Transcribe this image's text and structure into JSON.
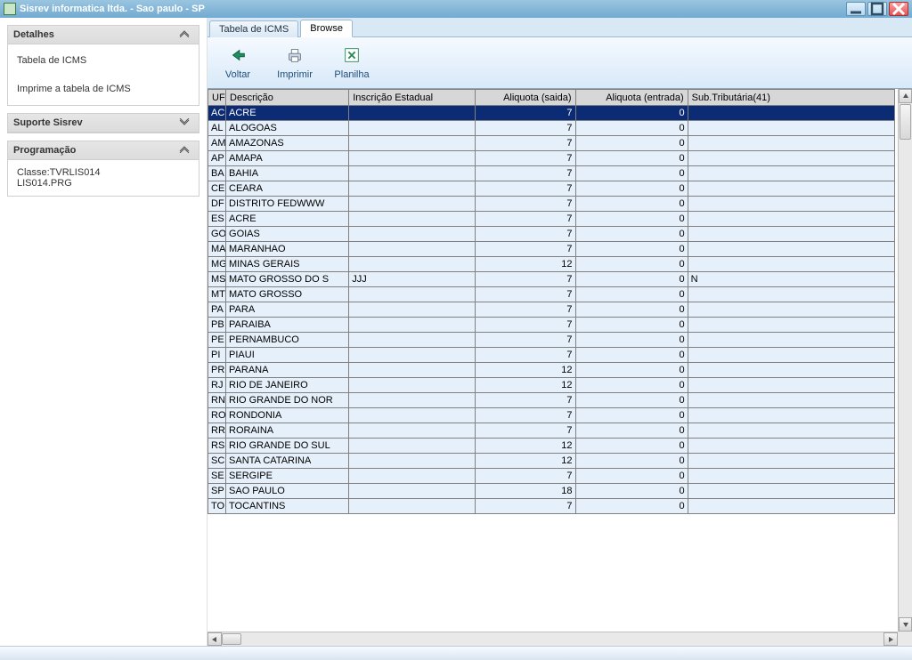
{
  "window": {
    "title": "Sisrev informatica ltda. - Sao paulo - SP"
  },
  "sidebar": {
    "detalhes": {
      "title": "Detalhes",
      "item1": "Tabela de ICMS",
      "item2": "Imprime a tabela de ICMS"
    },
    "suporte": {
      "title": "Suporte Sisrev"
    },
    "programacao": {
      "title": "Programação",
      "line1": "Classe:TVRLIS014",
      "line2": "LIS014.PRG"
    }
  },
  "tabs": {
    "tab1": "Tabela de ICMS",
    "tab2": "Browse"
  },
  "toolbar": {
    "voltar": "Voltar",
    "imprimir": "Imprimir",
    "planilha": "Planilha"
  },
  "grid": {
    "headers": {
      "uf": "UF",
      "desc": "Descrição",
      "insc": "Inscrição Estadual",
      "aliqs": "Aliquota (saida)",
      "aliqe": "Aliquota (entrada)",
      "sub": "Sub.Tributária(41)"
    },
    "rows": [
      {
        "uf": "AC",
        "desc": "ACRE",
        "insc": "",
        "aliqs": "7",
        "aliqe": "0",
        "sub": ""
      },
      {
        "uf": "AL",
        "desc": "ALOGOAS",
        "insc": "",
        "aliqs": "7",
        "aliqe": "0",
        "sub": ""
      },
      {
        "uf": "AM",
        "desc": "AMAZONAS",
        "insc": "",
        "aliqs": "7",
        "aliqe": "0",
        "sub": ""
      },
      {
        "uf": "AP",
        "desc": "AMAPA",
        "insc": "",
        "aliqs": "7",
        "aliqe": "0",
        "sub": ""
      },
      {
        "uf": "BA",
        "desc": "BAHIA",
        "insc": "",
        "aliqs": "7",
        "aliqe": "0",
        "sub": ""
      },
      {
        "uf": "CE",
        "desc": "CEARA",
        "insc": "",
        "aliqs": "7",
        "aliqe": "0",
        "sub": ""
      },
      {
        "uf": "DF",
        "desc": "DISTRITO FEDWWW",
        "insc": "",
        "aliqs": "7",
        "aliqe": "0",
        "sub": ""
      },
      {
        "uf": "ES",
        "desc": "ACRE",
        "insc": "",
        "aliqs": "7",
        "aliqe": "0",
        "sub": ""
      },
      {
        "uf": "GO",
        "desc": "GOIAS",
        "insc": "",
        "aliqs": "7",
        "aliqe": "0",
        "sub": ""
      },
      {
        "uf": "MA",
        "desc": "MARANHAO",
        "insc": "",
        "aliqs": "7",
        "aliqe": "0",
        "sub": ""
      },
      {
        "uf": "MG",
        "desc": "MINAS GERAIS",
        "insc": "",
        "aliqs": "12",
        "aliqe": "0",
        "sub": ""
      },
      {
        "uf": "MS",
        "desc": "MATO GROSSO DO S",
        "insc": "JJJ",
        "aliqs": "7",
        "aliqe": "0",
        "sub": "N"
      },
      {
        "uf": "MT",
        "desc": "MATO GROSSO",
        "insc": "",
        "aliqs": "7",
        "aliqe": "0",
        "sub": ""
      },
      {
        "uf": "PA",
        "desc": "PARA",
        "insc": "",
        "aliqs": "7",
        "aliqe": "0",
        "sub": ""
      },
      {
        "uf": "PB",
        "desc": "PARAIBA",
        "insc": "",
        "aliqs": "7",
        "aliqe": "0",
        "sub": ""
      },
      {
        "uf": "PE",
        "desc": "PERNAMBUCO",
        "insc": "",
        "aliqs": "7",
        "aliqe": "0",
        "sub": ""
      },
      {
        "uf": "PI",
        "desc": "PIAUI",
        "insc": "",
        "aliqs": "7",
        "aliqe": "0",
        "sub": ""
      },
      {
        "uf": "PR",
        "desc": "PARANA",
        "insc": "",
        "aliqs": "12",
        "aliqe": "0",
        "sub": ""
      },
      {
        "uf": "RJ",
        "desc": "RIO DE JANEIRO",
        "insc": "",
        "aliqs": "12",
        "aliqe": "0",
        "sub": ""
      },
      {
        "uf": "RN",
        "desc": "RIO GRANDE DO NOR",
        "insc": "",
        "aliqs": "7",
        "aliqe": "0",
        "sub": ""
      },
      {
        "uf": "RO",
        "desc": "RONDONIA",
        "insc": "",
        "aliqs": "7",
        "aliqe": "0",
        "sub": ""
      },
      {
        "uf": "RR",
        "desc": "RORAINA",
        "insc": "",
        "aliqs": "7",
        "aliqe": "0",
        "sub": ""
      },
      {
        "uf": "RS",
        "desc": "RIO GRANDE DO SUL",
        "insc": "",
        "aliqs": "12",
        "aliqe": "0",
        "sub": ""
      },
      {
        "uf": "SC",
        "desc": "SANTA CATARINA",
        "insc": "",
        "aliqs": "12",
        "aliqe": "0",
        "sub": ""
      },
      {
        "uf": "SE",
        "desc": "SERGIPE",
        "insc": "",
        "aliqs": "7",
        "aliqe": "0",
        "sub": ""
      },
      {
        "uf": "SP",
        "desc": "SAO PAULO",
        "insc": "",
        "aliqs": "18",
        "aliqe": "0",
        "sub": ""
      },
      {
        "uf": "TO",
        "desc": "TOCANTINS",
        "insc": "",
        "aliqs": "7",
        "aliqe": "0",
        "sub": ""
      }
    ],
    "selected_index": 0
  }
}
